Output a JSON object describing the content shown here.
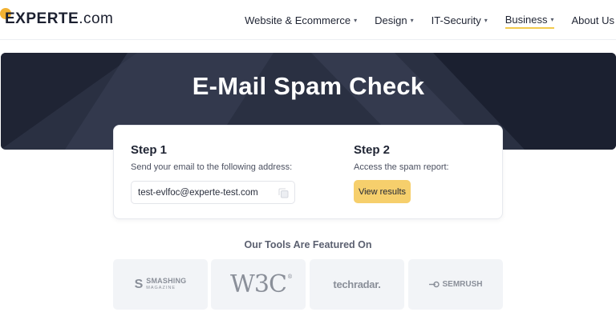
{
  "header": {
    "logo": {
      "brand": "EXPERTE",
      "tld": ".com"
    },
    "nav": [
      {
        "label": "Website & Ecommerce",
        "dropdown": true
      },
      {
        "label": "Design",
        "dropdown": true
      },
      {
        "label": "IT-Security",
        "dropdown": true
      },
      {
        "label": "Business",
        "dropdown": true,
        "active": true
      },
      {
        "label": "About Us",
        "dropdown": false
      }
    ]
  },
  "hero": {
    "title": "E-Mail Spam Check"
  },
  "steps": {
    "step1": {
      "title": "Step 1",
      "description": "Send your email to the following address:",
      "email": "test-evlfoc@experte-test.com",
      "copy_icon": "copy-icon"
    },
    "step2": {
      "title": "Step 2",
      "description": "Access the spam report:",
      "button": "View results"
    }
  },
  "featured": {
    "title": "Our Tools Are Featured On",
    "logos": [
      {
        "name": "smashing-magazine-logo",
        "text_main": "SMASHING",
        "text_sub": "MAGAZINE"
      },
      {
        "name": "w3c-logo",
        "text": "W3C"
      },
      {
        "name": "techradar-logo",
        "text": "techradar."
      },
      {
        "name": "semrush-logo",
        "text": "SEMRUSH"
      }
    ]
  },
  "colors": {
    "accent": "#f2b233",
    "button": "#f6cf6c",
    "hero_bg": "#2a3042",
    "tile_bg": "#f2f4f7"
  }
}
